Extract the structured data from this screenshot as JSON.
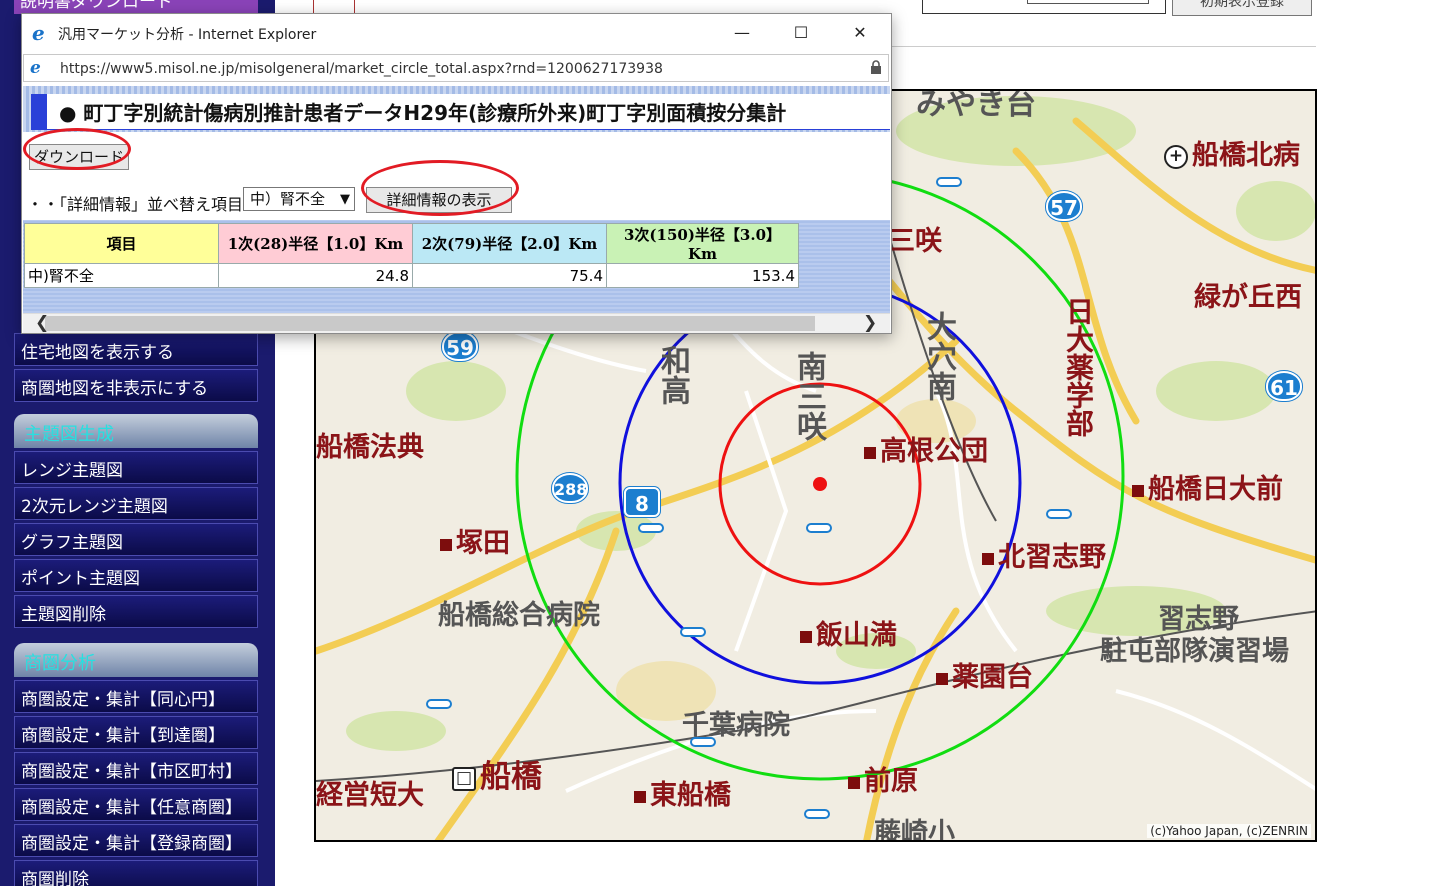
{
  "left_menu": {
    "top_item": "説明書ダウンロード",
    "map_items": [
      "住宅地図を表示する",
      "商圏地図を非表示にする"
    ],
    "sections": [
      {
        "heading": "主題図生成",
        "items": [
          "レンジ主題図",
          "2次元レンジ主題図",
          "グラフ主題図",
          "ポイント主題図",
          "主題図削除"
        ]
      },
      {
        "heading": "商圏分析",
        "items": [
          "商圏設定・集計【同心円】",
          "商圏設定・集計【到達圏】",
          "商圏設定・集計【市区町村】",
          "商圏設定・集計【任意商圏】",
          "商圏設定・集計【登録商圏】",
          "商圏削除"
        ]
      }
    ]
  },
  "top_bar": {
    "button_label": "初期表示登録"
  },
  "popup": {
    "window_title": "汎用マーケット分析 - Internet Explorer",
    "url": "https://www5.misol.ne.jp/misolgeneral/market_circle_total.aspx?rnd=1200627173938",
    "heading": "● 町丁字別統計傷病別推計患者データH29年(診療所外来)町丁字別面積按分集計",
    "download_label": "ダウンロード",
    "sort_label": "・・「詳細情報」並べ替え項目",
    "sort_selected": "中）腎不全",
    "detail_button_label": "詳細情報の表示",
    "table": {
      "headers": [
        "項目",
        "1次(28)半径【1.0】Km",
        "2次(79)半径【2.0】Km",
        "3次(150)半径【3.0】Km"
      ],
      "rows": [
        {
          "label": "中)腎不全",
          "v1": "24.8",
          "v2": "75.4",
          "v3": "153.4"
        }
      ]
    }
  },
  "map": {
    "labels": {
      "funabashi_kita": "船橋北病",
      "misaki": "三咲",
      "midorigaoka": "緑が丘西",
      "nichidai": "日大薬学部",
      "owada": "大穴南",
      "wada": "和高",
      "minami_sakiki": "南三咲",
      "takane": "高根公団",
      "hoten": "船橋法典",
      "nichidai_mae": "船橋日大前",
      "tsukada": "塚田",
      "kita_narashino": "北習志野",
      "sogo_byoin": "船橋総合病院",
      "iiyama": "飯山満",
      "narashino": "習志野",
      "enshujo": "駐屯部隊演習場",
      "yakuendai": "薬園台",
      "chiba_byoin": "千葉病院",
      "funabashi": "船橋",
      "higashi_funabashi": "東船橋",
      "maebara": "前原",
      "tanki": "経営短大",
      "fujisaki": "藤崎小",
      "miyakoji": "みやき台"
    },
    "route_numbers": [
      "57",
      "59",
      "61",
      "288",
      "8"
    ],
    "copyright": "(c)Yahoo Japan, (c)ZENRIN",
    "circle_colors": {
      "r1": "#ee1111",
      "r2": "#1010dd",
      "r3": "#11dd11"
    }
  }
}
